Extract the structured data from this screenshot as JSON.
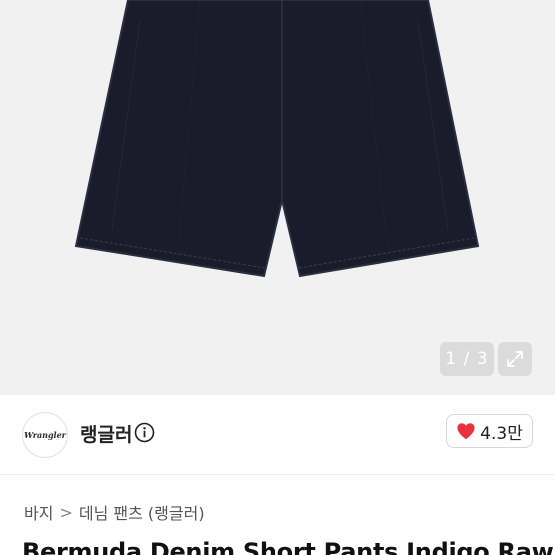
{
  "gallery": {
    "current_index": "1",
    "separator": "/",
    "total": "3",
    "background_color": "#f1f1f1",
    "product_color": "#1a1c2c"
  },
  "seller": {
    "logo_text": "Wrangler",
    "shop_name": "랭글러"
  },
  "likes": {
    "count": "4.3만",
    "heart_color": "#e8323e"
  },
  "breadcrumb": {
    "items": [
      "바지",
      "데님 팬츠 (랭글러)"
    ],
    "separator": ">"
  },
  "product": {
    "title": "Bermuda Denim Short Pants Indigo Raw"
  }
}
